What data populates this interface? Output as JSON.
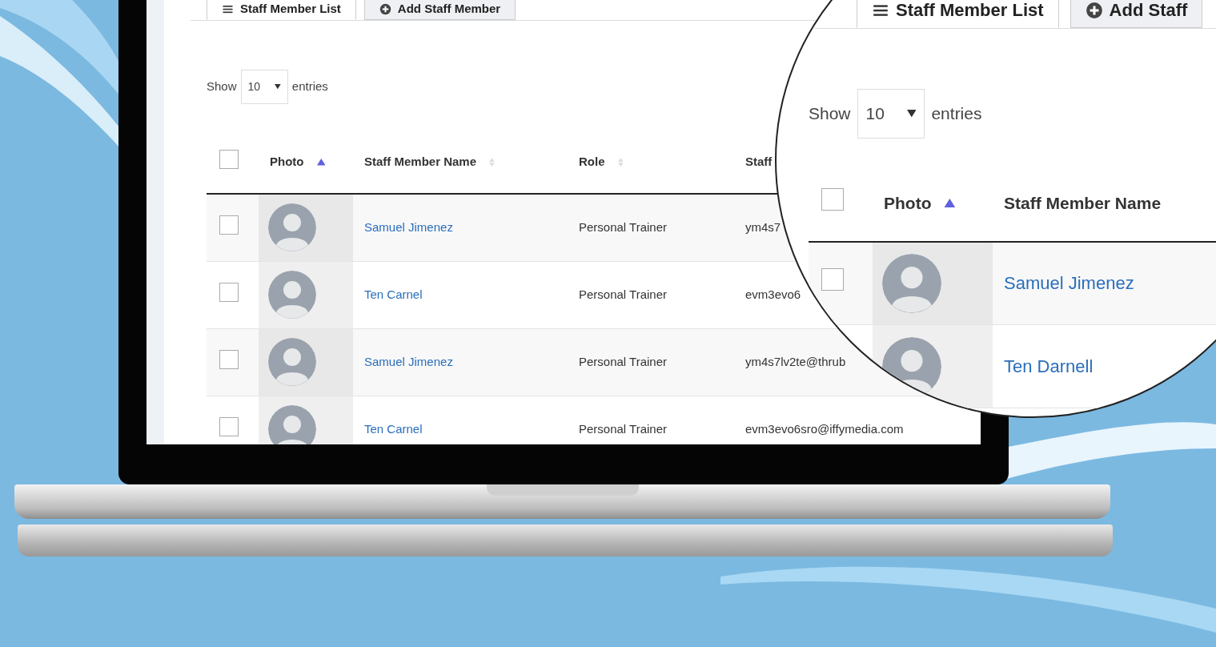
{
  "screen": {
    "tabs": [
      {
        "label": "Staff Member List",
        "selected": true
      },
      {
        "label": "Add Staff Member",
        "selected": false
      }
    ],
    "length_menu": {
      "prefix": "Show",
      "value": "10",
      "suffix": "entries"
    },
    "table": {
      "select_all": {
        "checked": false
      },
      "columns": [
        {
          "label": "Photo",
          "sorted": true
        },
        {
          "label": "Staff Member Name",
          "sorted": false
        },
        {
          "label": "Role",
          "sorted": false
        },
        {
          "label": "Staff"
        }
      ],
      "rows": [
        {
          "checked": false,
          "name": "Samuel Jimenez",
          "role": "Personal Trainer",
          "column_4": "ym4s7"
        },
        {
          "checked": false,
          "name": "Ten Carnel",
          "role": "Personal Trainer",
          "column_4": "evm3evo6"
        },
        {
          "checked": false,
          "name": "Samuel Jimenez",
          "role": "Personal Trainer",
          "column_4": "ym4s7lv2te@thrub"
        },
        {
          "checked": false,
          "name": "Ten Carnel",
          "role": "Personal Trainer",
          "column_4": "evm3evo6sro@iffymedia.com"
        }
      ]
    }
  },
  "magnifier": {
    "tabs": [
      {
        "label": "Staff Member List",
        "selected": true
      },
      {
        "label": "Add Staff",
        "selected": false
      }
    ],
    "length_menu": {
      "prefix": "Show",
      "value": "10",
      "suffix": "entries"
    },
    "table": {
      "select_all": {
        "checked": false
      },
      "columns": [
        {
          "label": "Photo",
          "sorted": true
        },
        {
          "label": "Staff Member Name"
        }
      ],
      "rows": [
        {
          "checked": false,
          "name": "Samuel Jimenez"
        },
        {
          "name": "Ten Darnell"
        }
      ]
    }
  }
}
